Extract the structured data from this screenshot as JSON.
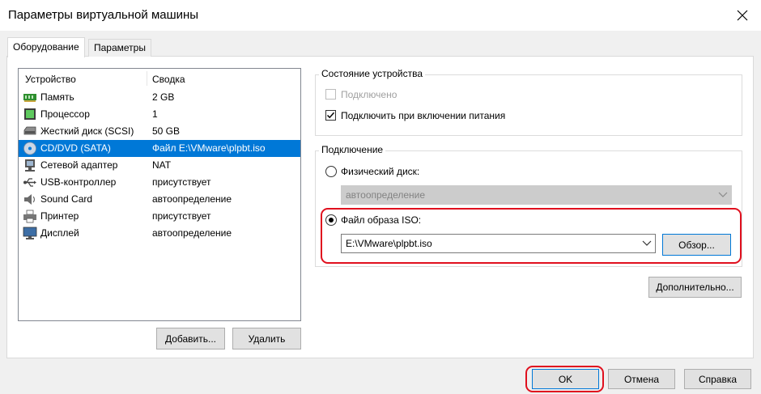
{
  "window": {
    "title": "Параметры виртуальной машины",
    "close_icon": "close-icon"
  },
  "tabs": [
    {
      "label": "Оборудование",
      "active": true
    },
    {
      "label": "Параметры",
      "active": false
    }
  ],
  "device_list": {
    "headers": {
      "device": "Устройство",
      "summary": "Сводка"
    },
    "rows": [
      {
        "device": "Память",
        "summary": "2 GB",
        "icon": "memory-icon"
      },
      {
        "device": "Процессор",
        "summary": "1",
        "icon": "cpu-icon"
      },
      {
        "device": "Жесткий диск (SCSI)",
        "summary": "50 GB",
        "icon": "hard-disk-icon"
      },
      {
        "device": "CD/DVD (SATA)",
        "summary": "Файл E:\\VMware\\plpbt.iso",
        "icon": "cd-dvd-icon",
        "selected": true
      },
      {
        "device": "Сетевой адаптер",
        "summary": "NAT",
        "icon": "network-adapter-icon"
      },
      {
        "device": "USB-контроллер",
        "summary": "присутствует",
        "icon": "usb-icon"
      },
      {
        "device": "Sound Card",
        "summary": "автоопределение",
        "icon": "speaker-icon"
      },
      {
        "device": "Принтер",
        "summary": "присутствует",
        "icon": "printer-icon"
      },
      {
        "device": "Дисплей",
        "summary": "автоопределение",
        "icon": "monitor-icon"
      }
    ]
  },
  "list_buttons": {
    "add": "Добавить...",
    "remove": "Удалить"
  },
  "device_status": {
    "title": "Состояние устройства",
    "connected": {
      "label": "Подключено",
      "checked": false,
      "disabled": true
    },
    "connect_at_power_on": {
      "label": "Подключить при включении питания",
      "checked": true
    }
  },
  "connection": {
    "title": "Подключение",
    "physical": {
      "label": "Физический диск:",
      "selected": false,
      "value": "автоопределение"
    },
    "iso": {
      "label": "Файл образа ISO:",
      "selected": true,
      "value": "E:\\VMware\\plpbt.iso"
    },
    "browse_label": "Обзор..."
  },
  "advanced_label": "Дополнительно...",
  "footer": {
    "ok": "OK",
    "cancel": "Отмена",
    "help": "Справка"
  },
  "colors": {
    "selection": "#0078d7",
    "highlight_ring": "#e0101e",
    "dialog_bg": "#f0f0f0"
  }
}
